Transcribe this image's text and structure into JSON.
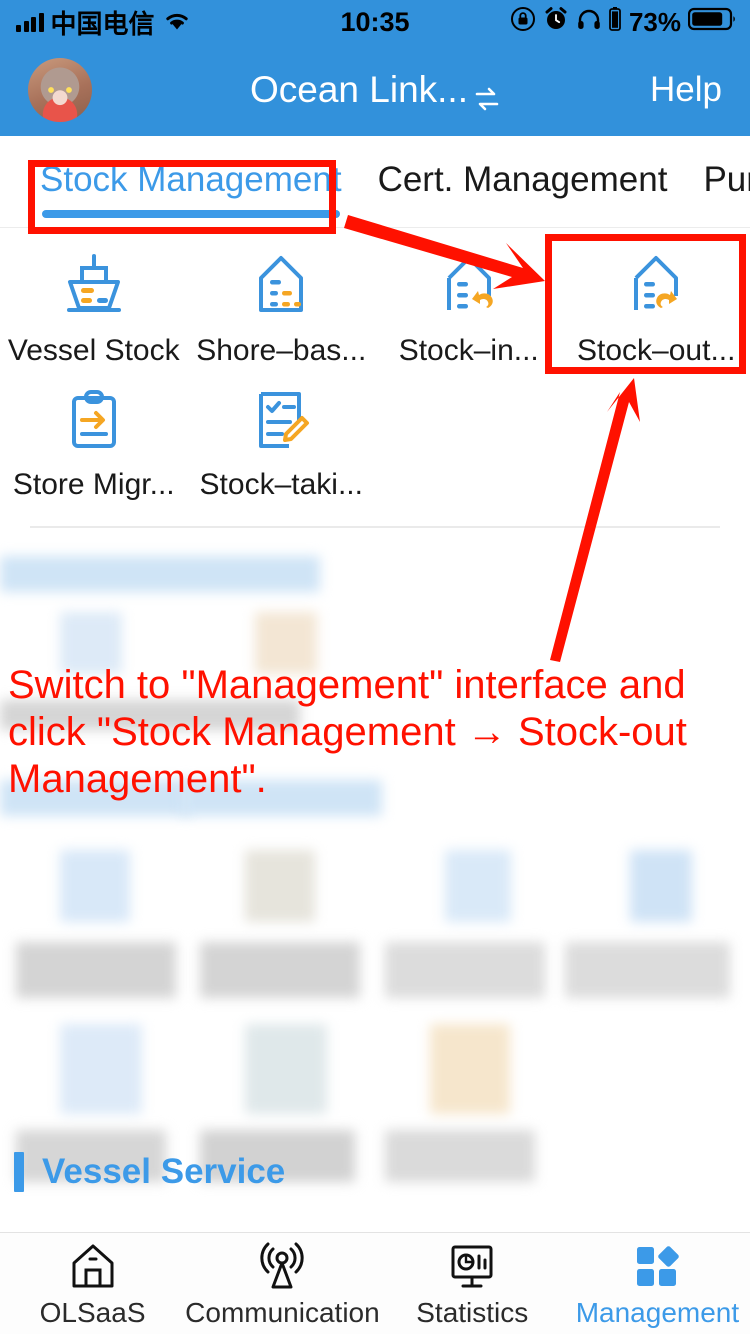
{
  "statusbar": {
    "carrier": "中国电信",
    "time": "10:35",
    "battery_pct": "73%",
    "icons": {
      "signal": "signal-bars-icon",
      "wifi": "wifi-icon",
      "rotation_lock": "rotation-lock-icon",
      "alarm": "alarm-clock-icon",
      "headphones": "headphones-icon",
      "battery_small": "battery-small-icon",
      "battery": "battery-icon"
    }
  },
  "header": {
    "title": "Ocean Link...",
    "sync_icon": "sync-switch-icon",
    "help_label": "Help",
    "avatar": "user-avatar"
  },
  "tabs": [
    {
      "label": "Stock Management",
      "active": true
    },
    {
      "label": "Cert. Management",
      "active": false
    },
    {
      "label": "Purch",
      "active": false
    }
  ],
  "grid": {
    "row1": [
      {
        "label": "Vessel Stock",
        "icon": "vessel-stock-icon"
      },
      {
        "label": "Shore–bas...",
        "icon": "shore-based-stock-icon"
      },
      {
        "label": "Stock–in...",
        "icon": "stock-in-icon"
      },
      {
        "label": "Stock–out...",
        "icon": "stock-out-icon"
      }
    ],
    "row2": [
      {
        "label": "Store Migr...",
        "icon": "store-migration-icon"
      },
      {
        "label": "Stock–taki...",
        "icon": "stock-taking-icon"
      }
    ]
  },
  "section": {
    "title": "Vessel Service"
  },
  "tabbar": [
    {
      "label": "OLSaaS",
      "icon": "home-icon",
      "active": false
    },
    {
      "label": "Communication",
      "icon": "broadcast-icon",
      "active": false
    },
    {
      "label": "Statistics",
      "icon": "monitor-chart-icon",
      "active": false
    },
    {
      "label": "Management",
      "icon": "grid-blocks-icon",
      "active": true
    }
  ],
  "annotation": {
    "text": "Switch to \"Management\" interface and click \"Stock Management → Stock-out Management\".",
    "color": "#FF1100",
    "boxes": [
      "tab-stock-management-highlight",
      "stock-out-cell-highlight"
    ],
    "arrows": [
      "arrow-to-stock-out-cell",
      "arrow-from-text-to-stock-out"
    ]
  },
  "colors": {
    "accent_blue": "#3C9AE8",
    "header_blue": "#3291DB",
    "icon_orange": "#F5A623",
    "annotation_red": "#FF1100"
  }
}
